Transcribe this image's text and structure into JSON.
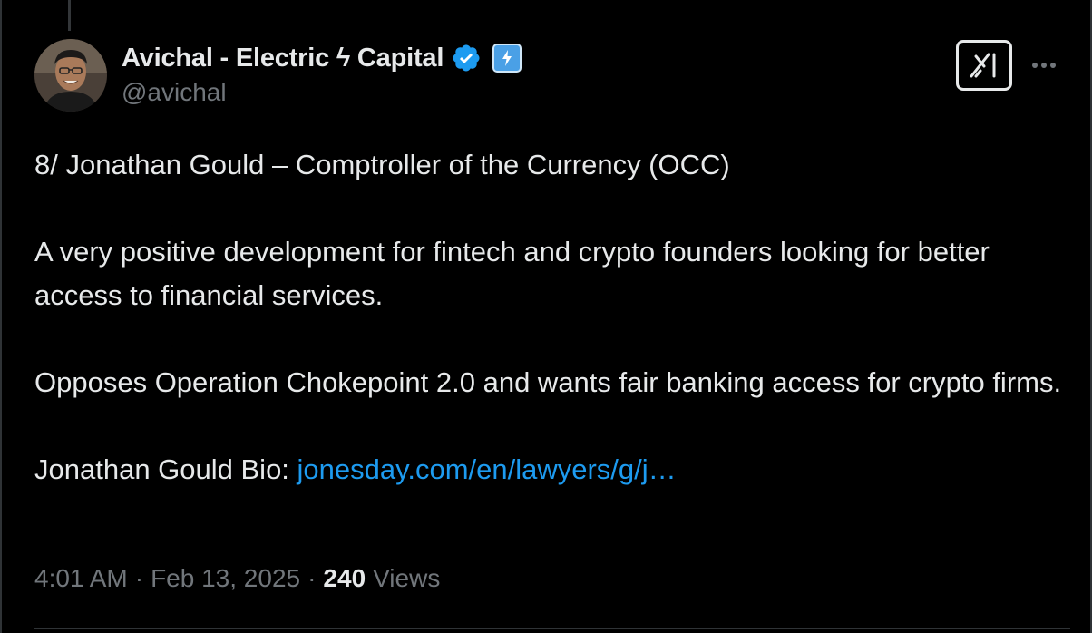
{
  "author": {
    "display_name": "Avichal - Electric ϟ Capital",
    "handle": "@avichal",
    "verified_icon": "verified-badge-icon",
    "affiliation_icon": "lightning-bolt-icon"
  },
  "actions": {
    "grok_icon": "grok-icon",
    "more_icon": "more-options-icon"
  },
  "tweet": {
    "line1": "8/ Jonathan Gould – Comptroller of the Currency (OCC)",
    "para2": "A very positive development for fintech and crypto founders looking for better access to financial services.",
    "para3": "Opposes Operation Chokepoint 2.0 and wants fair banking access for crypto firms.",
    "bio_label": "Jonathan Gould Bio: ",
    "bio_link": "jonesday.com/en/lawyers/g/j…"
  },
  "meta": {
    "time": "4:01 AM",
    "date": "Feb 13, 2025",
    "separator": "·",
    "views_count": "240",
    "views_label": "Views"
  },
  "colors": {
    "background": "#000000",
    "text": "#e7e9ea",
    "secondary": "#71767b",
    "link": "#1d9bf0",
    "verified": "#1d9bf0"
  }
}
